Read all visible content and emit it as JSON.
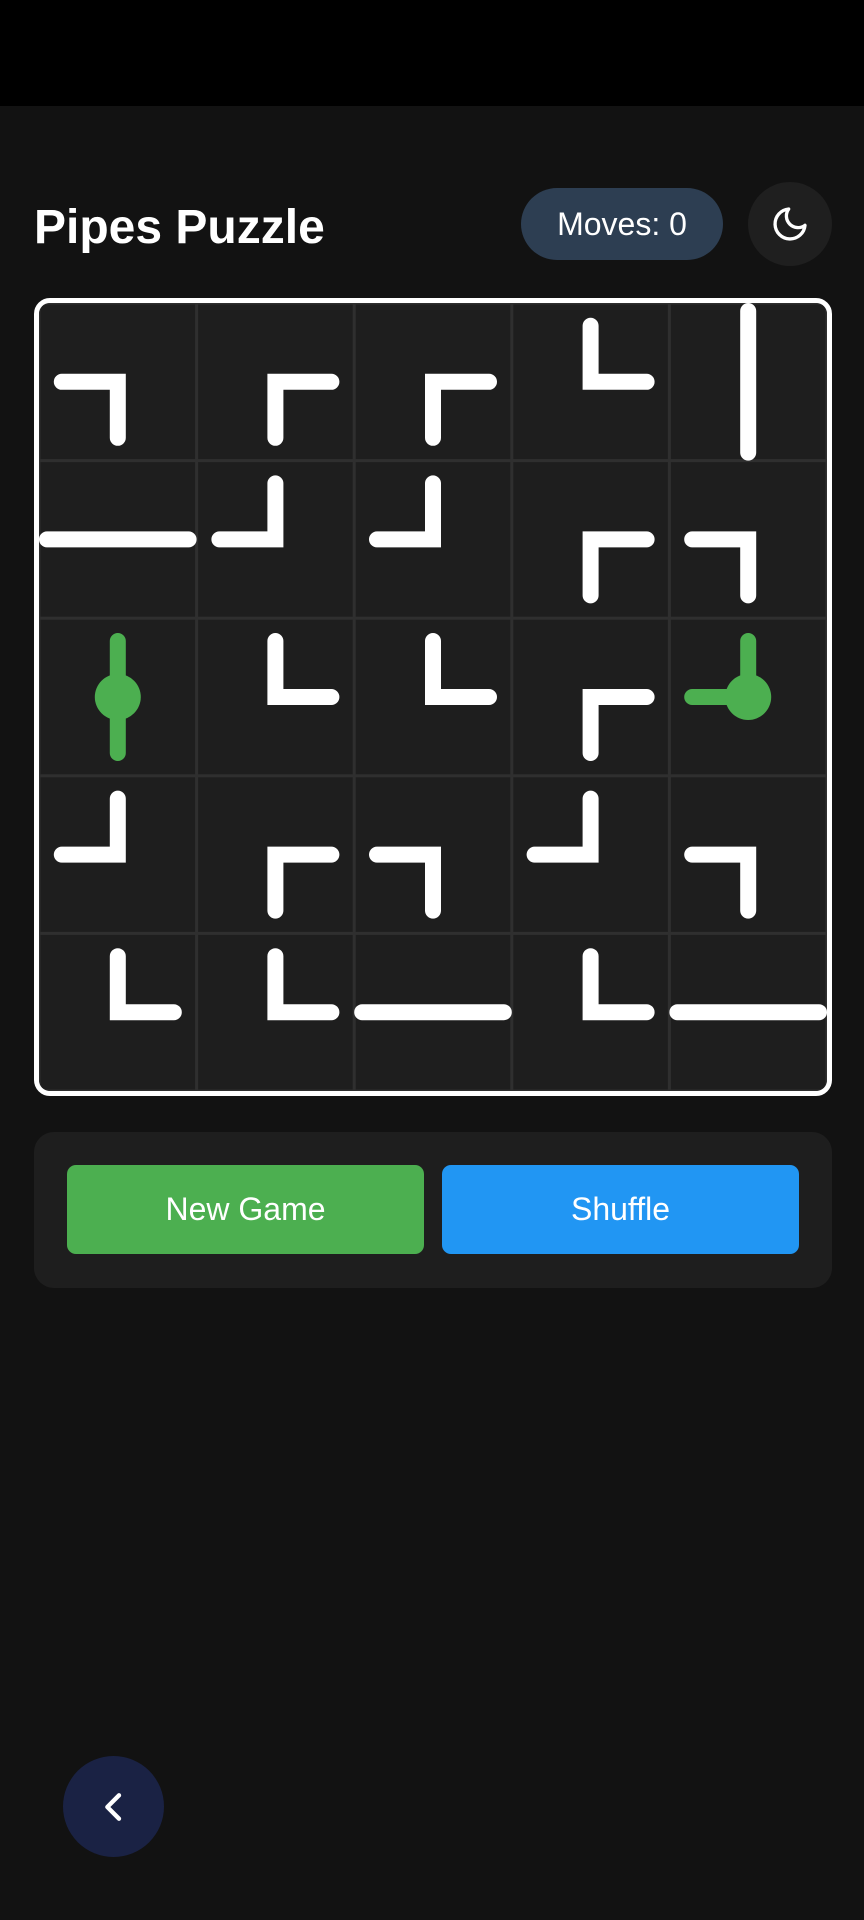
{
  "header": {
    "title": "Pipes Puzzle",
    "moves_text": "Moves: 0",
    "theme_icon": "moon-icon"
  },
  "board": {
    "rows": 5,
    "cols": 5,
    "pipe_color": "#ffffff",
    "source_color": "#4caf50",
    "cell_color": "#1e1e1e",
    "grid_color": "#2f2f2f",
    "cells": [
      [
        {
          "type": "elbow",
          "dirs": [
            "left",
            "down"
          ]
        },
        {
          "type": "elbow",
          "dirs": [
            "right",
            "down"
          ]
        },
        {
          "type": "elbow",
          "dirs": [
            "right",
            "down"
          ]
        },
        {
          "type": "elbow",
          "dirs": [
            "up",
            "right"
          ]
        },
        {
          "type": "straight",
          "dirs": [
            "up",
            "down"
          ]
        }
      ],
      [
        {
          "type": "straight",
          "dirs": [
            "left",
            "right"
          ]
        },
        {
          "type": "elbow",
          "dirs": [
            "up",
            "left"
          ]
        },
        {
          "type": "elbow",
          "dirs": [
            "up",
            "left"
          ]
        },
        {
          "type": "elbow",
          "dirs": [
            "right",
            "down"
          ]
        },
        {
          "type": "elbow",
          "dirs": [
            "left",
            "down"
          ]
        }
      ],
      [
        {
          "type": "source",
          "dirs": [
            "up",
            "down"
          ]
        },
        {
          "type": "elbow",
          "dirs": [
            "up",
            "right"
          ]
        },
        {
          "type": "elbow",
          "dirs": [
            "up",
            "right"
          ]
        },
        {
          "type": "elbow",
          "dirs": [
            "right",
            "down"
          ]
        },
        {
          "type": "source",
          "dirs": [
            "up",
            "left"
          ]
        }
      ],
      [
        {
          "type": "elbow",
          "dirs": [
            "up",
            "left"
          ]
        },
        {
          "type": "elbow",
          "dirs": [
            "right",
            "down"
          ]
        },
        {
          "type": "elbow",
          "dirs": [
            "left",
            "down"
          ]
        },
        {
          "type": "elbow",
          "dirs": [
            "up",
            "left"
          ]
        },
        {
          "type": "elbow",
          "dirs": [
            "left",
            "down"
          ]
        }
      ],
      [
        {
          "type": "elbow",
          "dirs": [
            "up",
            "right"
          ]
        },
        {
          "type": "elbow",
          "dirs": [
            "up",
            "right"
          ]
        },
        {
          "type": "straight",
          "dirs": [
            "left",
            "right"
          ]
        },
        {
          "type": "elbow",
          "dirs": [
            "up",
            "right"
          ]
        },
        {
          "type": "straight",
          "dirs": [
            "left",
            "right"
          ]
        }
      ]
    ]
  },
  "controls": {
    "new_game_label": "New Game",
    "shuffle_label": "Shuffle",
    "new_game_color": "#4caf50",
    "shuffle_color": "#2196f3"
  },
  "nav": {
    "back_icon": "chevron-left-icon"
  }
}
